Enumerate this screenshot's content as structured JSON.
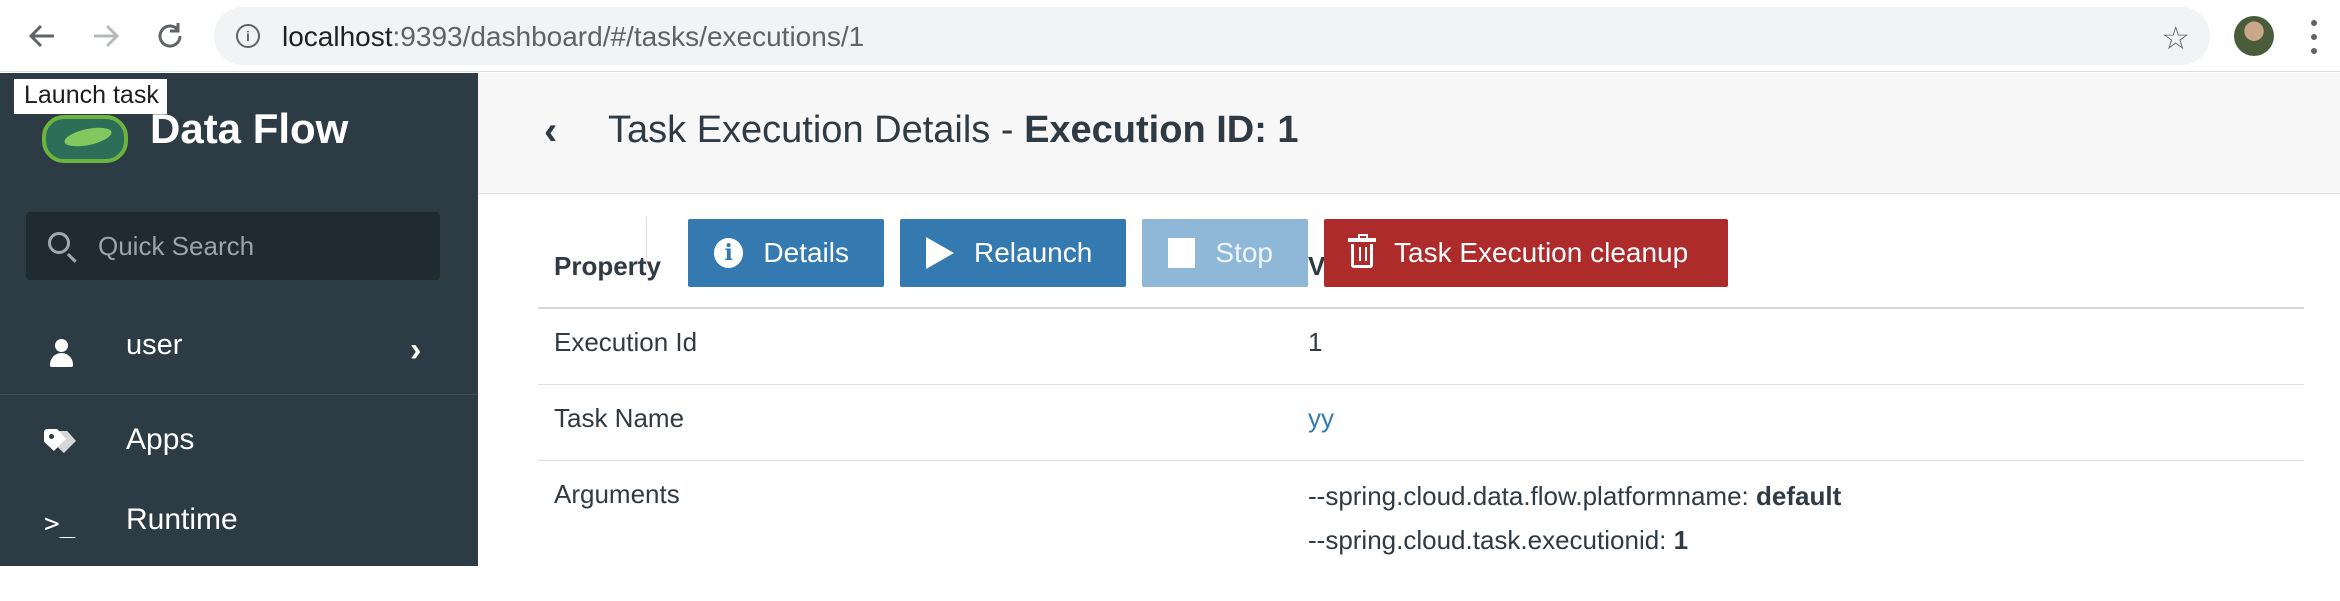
{
  "browser": {
    "url_host": "localhost",
    "url_rest": ":9393/dashboard/#/tasks/executions/1"
  },
  "sidebar": {
    "tooltip": "Launch task",
    "brand": "Data Flow",
    "search_placeholder": "Quick Search",
    "user_label": "user",
    "nav": [
      {
        "label": "Apps",
        "icon": "tags-icon"
      },
      {
        "label": "Runtime",
        "icon": "terminal-icon"
      }
    ]
  },
  "header": {
    "title_prefix": "Task Execution Details - ",
    "title_bold": "Execution ID: 1"
  },
  "toolbar": {
    "details": "Details",
    "relaunch": "Relaunch",
    "stop": "Stop",
    "cleanup": "Task Execution cleanup"
  },
  "table": {
    "col_property": "Property",
    "col_value": "V",
    "rows": [
      {
        "key": "Execution Id",
        "value": "1"
      },
      {
        "key": "Task Name",
        "value": "yy"
      },
      {
        "key": "Arguments"
      }
    ],
    "arguments": [
      {
        "name": "--spring.cloud.data.flow.platformname: ",
        "value": "default"
      },
      {
        "name": "--spring.cloud.task.executionid: ",
        "value": "1"
      }
    ]
  },
  "colors": {
    "sidebar_bg": "#2d3b45",
    "primary": "#3579b1",
    "danger": "#ad2b2b",
    "disabled": "#8eb7d8"
  }
}
